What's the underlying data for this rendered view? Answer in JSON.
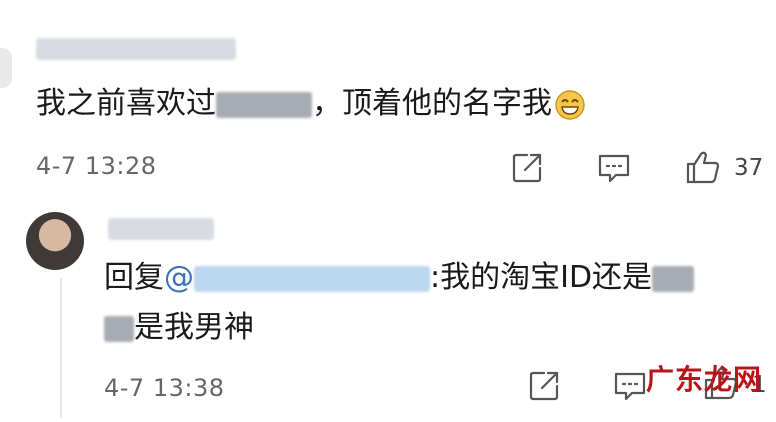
{
  "comment": {
    "text_prefix": "我之前喜欢过",
    "text_suffix": "，顶着他的名字我",
    "time": "4-7 13:28",
    "like_count": "37",
    "icons": [
      "share-icon",
      "reply-icon",
      "like-icon",
      "grin-emoji-icon"
    ]
  },
  "reply": {
    "prefix": "回复",
    "at": "@",
    "text_after_name": ":我的淘宝ID还是",
    "line2": "是我男神",
    "time": "4-7 13:38",
    "like_count": "1"
  },
  "watermark": {
    "text": "广东龙网"
  }
}
